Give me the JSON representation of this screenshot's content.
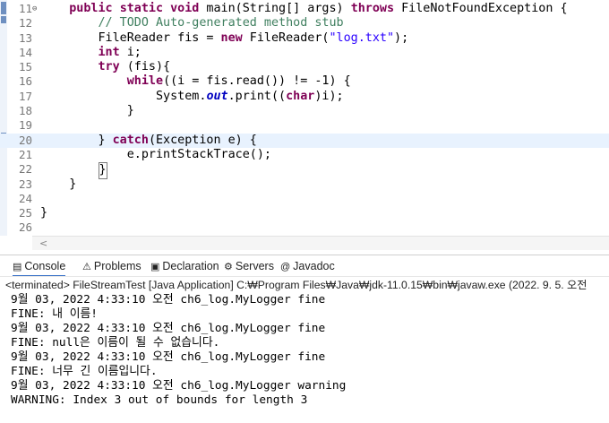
{
  "editor": {
    "lines": [
      {
        "num": "11",
        "fold": "⊖",
        "parts": [
          {
            "t": "    "
          },
          {
            "c": "kw",
            "t": "public"
          },
          {
            "t": " "
          },
          {
            "c": "kw",
            "t": "static"
          },
          {
            "t": " "
          },
          {
            "c": "kw",
            "t": "void"
          },
          {
            "t": " main(String[] args) "
          },
          {
            "c": "kw",
            "t": "throws"
          },
          {
            "t": " FileNotFoundException {"
          }
        ]
      },
      {
        "num": "12",
        "fold": "",
        "parts": [
          {
            "t": "        "
          },
          {
            "c": "cm",
            "t": "// TODO Auto-generated method stub"
          }
        ]
      },
      {
        "num": "13",
        "fold": "",
        "parts": [
          {
            "t": "        FileReader fis = "
          },
          {
            "c": "kw",
            "t": "new"
          },
          {
            "t": " FileReader("
          },
          {
            "c": "str",
            "t": "\"log.txt\""
          },
          {
            "t": ");"
          }
        ]
      },
      {
        "num": "14",
        "fold": "",
        "parts": [
          {
            "t": "        "
          },
          {
            "c": "kw",
            "t": "int"
          },
          {
            "t": " i;"
          }
        ]
      },
      {
        "num": "15",
        "fold": "",
        "parts": [
          {
            "t": "        "
          },
          {
            "c": "kw",
            "t": "try"
          },
          {
            "t": " (fis){"
          }
        ]
      },
      {
        "num": "16",
        "fold": "",
        "parts": [
          {
            "t": "            "
          },
          {
            "c": "kw",
            "t": "while"
          },
          {
            "t": "((i = fis.read()) != -1) {"
          }
        ]
      },
      {
        "num": "17",
        "fold": "",
        "parts": [
          {
            "t": "                System."
          },
          {
            "c": "it",
            "t": "out"
          },
          {
            "t": ".print(("
          },
          {
            "c": "kw",
            "t": "char"
          },
          {
            "t": ")i);"
          }
        ]
      },
      {
        "num": "18",
        "fold": "",
        "parts": [
          {
            "t": "            }"
          }
        ]
      },
      {
        "num": "19",
        "fold": "",
        "parts": [
          {
            "t": ""
          }
        ]
      },
      {
        "num": "20",
        "fold": "",
        "current": true,
        "parts": [
          {
            "t": "        } "
          },
          {
            "c": "kw",
            "t": "catch"
          },
          {
            "t": "(Exception e) {"
          }
        ]
      },
      {
        "num": "21",
        "fold": "",
        "parts": [
          {
            "t": "            e.printStackTrace();"
          }
        ]
      },
      {
        "num": "22",
        "fold": "",
        "parts": [
          {
            "t": "        "
          },
          {
            "c": "caret",
            "t": "}"
          }
        ]
      },
      {
        "num": "23",
        "fold": "",
        "parts": [
          {
            "t": "    }"
          }
        ]
      },
      {
        "num": "24",
        "fold": "",
        "parts": [
          {
            "t": ""
          }
        ]
      },
      {
        "num": "25",
        "fold": "",
        "parts": [
          {
            "t": "}"
          }
        ]
      },
      {
        "num": "26",
        "fold": "",
        "parts": [
          {
            "t": ""
          }
        ]
      }
    ],
    "hscroll_arrow": "<"
  },
  "tabs": [
    {
      "label": "Console",
      "icon": "console-icon",
      "glyph": "▤",
      "active": true
    },
    {
      "label": "Problems",
      "icon": "problems-icon",
      "glyph": "⚠",
      "active": false
    },
    {
      "label": "Declaration",
      "icon": "declaration-icon",
      "glyph": "▣",
      "active": false
    },
    {
      "label": "Servers",
      "icon": "servers-icon",
      "glyph": "⚙",
      "active": false
    },
    {
      "label": "Javadoc",
      "icon": "javadoc-icon",
      "glyph": "@",
      "active": false
    }
  ],
  "console": {
    "status": "<terminated> FileStreamTest [Java Application] C:₩Program Files₩Java₩jdk-11.0.15₩bin₩javaw.exe  (2022. 9. 5. 오전",
    "output": [
      "9월 03, 2022 4:33:10 오전 ch6_log.MyLogger fine",
      "FINE: 내 이름!",
      "9월 03, 2022 4:33:10 오전 ch6_log.MyLogger fine",
      "FINE: null은 이름이 될 수 없습니다.",
      "9월 03, 2022 4:33:10 오전 ch6_log.MyLogger fine",
      "FINE: 너무 긴 이름입니다.",
      "9월 03, 2022 4:33:10 오전 ch6_log.MyLogger warning",
      "WARNING: Index 3 out of bounds for length 3"
    ]
  },
  "colors": {
    "keyword": "#7f0055",
    "comment": "#3f7f5f",
    "string": "#2a00ff",
    "field": "#0000c0",
    "tab_accent": "#3b73c8"
  }
}
